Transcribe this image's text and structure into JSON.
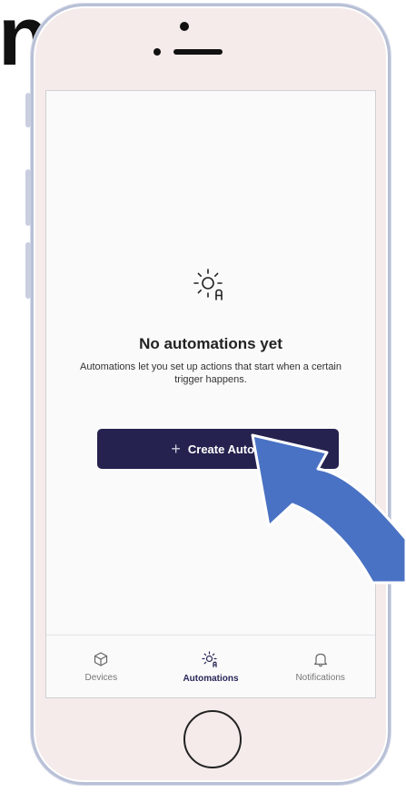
{
  "empty_state": {
    "icon": "sun-automation-icon",
    "title": "No automations yet",
    "description": "Automations let you set up actions that start when a certain trigger happens."
  },
  "create_button": {
    "label": "Create Autom",
    "icon": "plus-icon"
  },
  "tabbar": {
    "tabs": [
      {
        "label": "Devices",
        "icon": "cube-icon",
        "active": false
      },
      {
        "label": "Automations",
        "icon": "sun-automation-icon",
        "active": true
      },
      {
        "label": "Notifications",
        "icon": "bell-icon",
        "active": false
      }
    ]
  },
  "colors": {
    "primary": "#25224f",
    "phone_frame": "#f5ebea",
    "arrow": "#4a72c4"
  }
}
